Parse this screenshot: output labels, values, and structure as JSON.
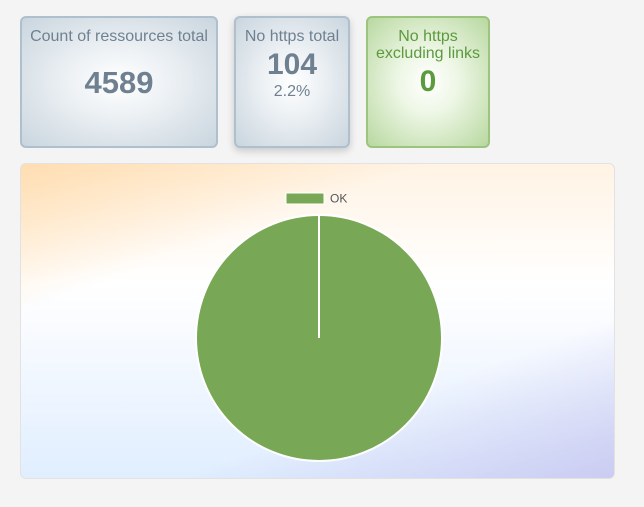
{
  "cards": [
    {
      "title": "Count of ressources total",
      "value": "4589",
      "sub": ""
    },
    {
      "title": "No https total",
      "value": "104",
      "sub": "2.2%"
    },
    {
      "title": "No https excluding links",
      "value": "0",
      "sub": ""
    }
  ],
  "colors": {
    "ok": "#78a855"
  },
  "chart_data": {
    "type": "pie",
    "categories": [
      "OK"
    ],
    "values": [
      100
    ],
    "legend_position": "top-center",
    "colors": [
      "#78a855"
    ]
  }
}
